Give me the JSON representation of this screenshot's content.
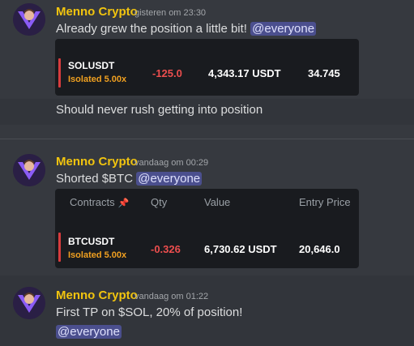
{
  "messages": [
    {
      "author": "Menno Crypto",
      "timestamp": "gisteren om 23:30",
      "text": "Already grew the position a little bit!",
      "mention": "@everyone",
      "card": {
        "symbol": "SOLUSDT",
        "leverage": "Isolated 5.00x",
        "qty": "-125.0",
        "value": "4,343.17 USDT",
        "entry_price": "34.745"
      }
    },
    {
      "text": "Should never rush getting into position"
    },
    {
      "author": "Menno Crypto",
      "timestamp": "vandaag om 00:29",
      "text": "Shorted $BTC",
      "mention": "@everyone",
      "card": {
        "headers": [
          "Contracts",
          "Qty",
          "Value",
          "Entry Price"
        ],
        "symbol": "BTCUSDT",
        "leverage": "Isolated 5.00x",
        "qty": "-0.326",
        "value": "6,730.62 USDT",
        "entry_price": "20,646.0"
      }
    },
    {
      "author": "Menno Crypto",
      "timestamp": "vandaag om 01:22",
      "text": "First TP on $SOL, 20% of position!",
      "mention": "@everyone"
    }
  ],
  "colors": {
    "background": "#36393f",
    "author": "#f1c40f",
    "mention_bg": "#4b4f8e",
    "negative": "#ec4e4e",
    "leverage": "#f0a020",
    "card_bg": "#191b1f"
  },
  "icons": {
    "avatar": "avatar-icon",
    "pin": "pin-icon"
  }
}
